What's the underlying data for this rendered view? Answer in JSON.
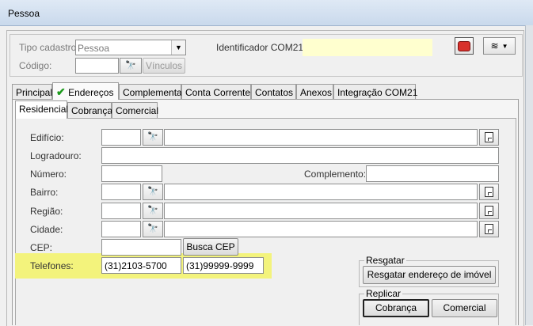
{
  "window": {
    "title": "Pessoa"
  },
  "header": {
    "tipo_cadastro_label": "Tipo cadastro",
    "tipo_cadastro_value": "Pessoa",
    "codigo_label": "Código:",
    "vinculos_label": "Vínculos",
    "identificador_label": "Identificador COM21:"
  },
  "tabs": [
    "Principal",
    "Endereços",
    "Complementar",
    "Conta Corrente",
    "Contatos",
    "Anexos",
    "Integração COM21"
  ],
  "subtabs": [
    "Residencial",
    "Cobrança",
    "Comercial"
  ],
  "form": {
    "edificio_label": "Edifício:",
    "logradouro_label": "Logradouro:",
    "numero_label": "Número:",
    "complemento_label": "Complemento:",
    "bairro_label": "Bairro:",
    "regiao_label": "Região:",
    "cidade_label": "Cidade:",
    "cep_label": "CEP:",
    "busca_cep_label": "Busca CEP",
    "telefones_label": "Telefones:",
    "telefone1": "(31)2103-5700",
    "telefone2": "(31)99999-9999"
  },
  "resgatar": {
    "title": "Resgatar",
    "button": "Resgatar endereço de imóvel"
  },
  "replicar": {
    "title": "Replicar",
    "cobranca": "Cobrança",
    "comercial": "Comercial"
  },
  "colors": {
    "highlight": "#f3f37c",
    "identificador_bg": "#ffffcf",
    "check": "#1a9a1a"
  }
}
